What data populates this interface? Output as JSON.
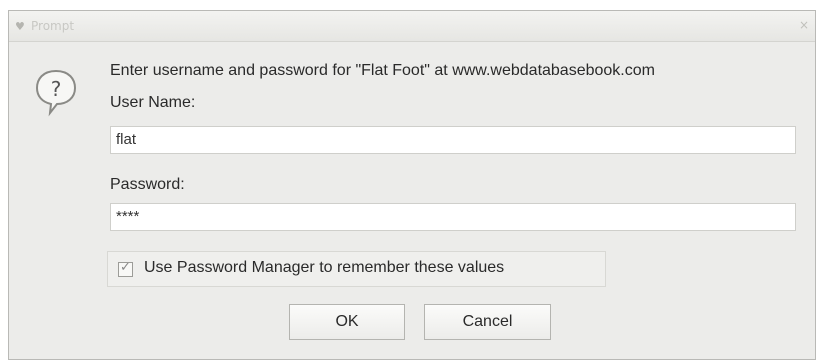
{
  "window": {
    "title": "Prompt",
    "close_glyph": "×"
  },
  "icons": {
    "app_icon": "app-logo-icon",
    "dialog_icon": "question-mark-bubble-icon"
  },
  "message": "Enter username and password for \"Flat Foot\" at www.webdatabasebook.com",
  "username": {
    "label": "User Name:",
    "value": "flat"
  },
  "password": {
    "label": "Password:",
    "value": "****"
  },
  "remember": {
    "label": "Use Password Manager to remember these values",
    "checked": true
  },
  "buttons": {
    "ok": "OK",
    "cancel": "Cancel"
  }
}
